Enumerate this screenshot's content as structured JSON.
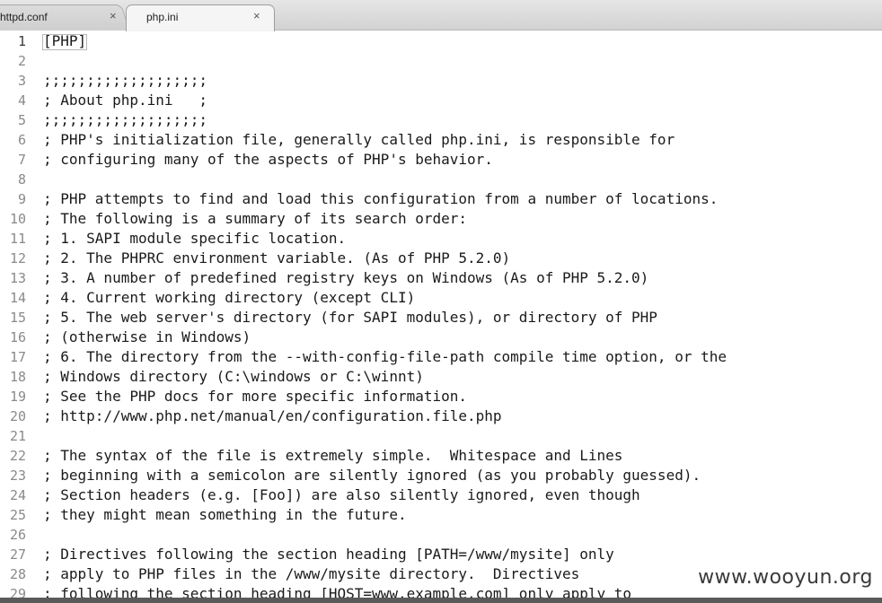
{
  "tabs": [
    {
      "label": "httpd.conf",
      "close": "×",
      "active": false
    },
    {
      "label": "php.ini",
      "close": "×",
      "active": true
    }
  ],
  "editor": {
    "lines": [
      {
        "num": "1",
        "text": "[PHP]"
      },
      {
        "num": "2",
        "text": ""
      },
      {
        "num": "3",
        "text": ";;;;;;;;;;;;;;;;;;;"
      },
      {
        "num": "4",
        "text": "; About php.ini   ;"
      },
      {
        "num": "5",
        "text": ";;;;;;;;;;;;;;;;;;;"
      },
      {
        "num": "6",
        "text": "; PHP's initialization file, generally called php.ini, is responsible for"
      },
      {
        "num": "7",
        "text": "; configuring many of the aspects of PHP's behavior."
      },
      {
        "num": "8",
        "text": ""
      },
      {
        "num": "9",
        "text": "; PHP attempts to find and load this configuration from a number of locations."
      },
      {
        "num": "10",
        "text": "; The following is a summary of its search order:"
      },
      {
        "num": "11",
        "text": "; 1. SAPI module specific location."
      },
      {
        "num": "12",
        "text": "; 2. The PHPRC environment variable. (As of PHP 5.2.0)"
      },
      {
        "num": "13",
        "text": "; 3. A number of predefined registry keys on Windows (As of PHP 5.2.0)"
      },
      {
        "num": "14",
        "text": "; 4. Current working directory (except CLI)"
      },
      {
        "num": "15",
        "text": "; 5. The web server's directory (for SAPI modules), or directory of PHP"
      },
      {
        "num": "16",
        "text": "; (otherwise in Windows)"
      },
      {
        "num": "17",
        "text": "; 6. The directory from the --with-config-file-path compile time option, or the"
      },
      {
        "num": "18",
        "text": "; Windows directory (C:\\windows or C:\\winnt)"
      },
      {
        "num": "19",
        "text": "; See the PHP docs for more specific information."
      },
      {
        "num": "20",
        "text": "; http://www.php.net/manual/en/configuration.file.php"
      },
      {
        "num": "21",
        "text": ""
      },
      {
        "num": "22",
        "text": "; The syntax of the file is extremely simple.  Whitespace and Lines"
      },
      {
        "num": "23",
        "text": "; beginning with a semicolon are silently ignored (as you probably guessed)."
      },
      {
        "num": "24",
        "text": "; Section headers (e.g. [Foo]) are also silently ignored, even though"
      },
      {
        "num": "25",
        "text": "; they might mean something in the future."
      },
      {
        "num": "26",
        "text": ""
      },
      {
        "num": "27",
        "text": "; Directives following the section heading [PATH=/www/mysite] only"
      },
      {
        "num": "28",
        "text": "; apply to PHP files in the /www/mysite directory.  Directives"
      },
      {
        "num": "29",
        "text": "; following the section heading [HOST=www.example.com] only apply to"
      }
    ]
  },
  "watermark": "www.wooyun.org"
}
